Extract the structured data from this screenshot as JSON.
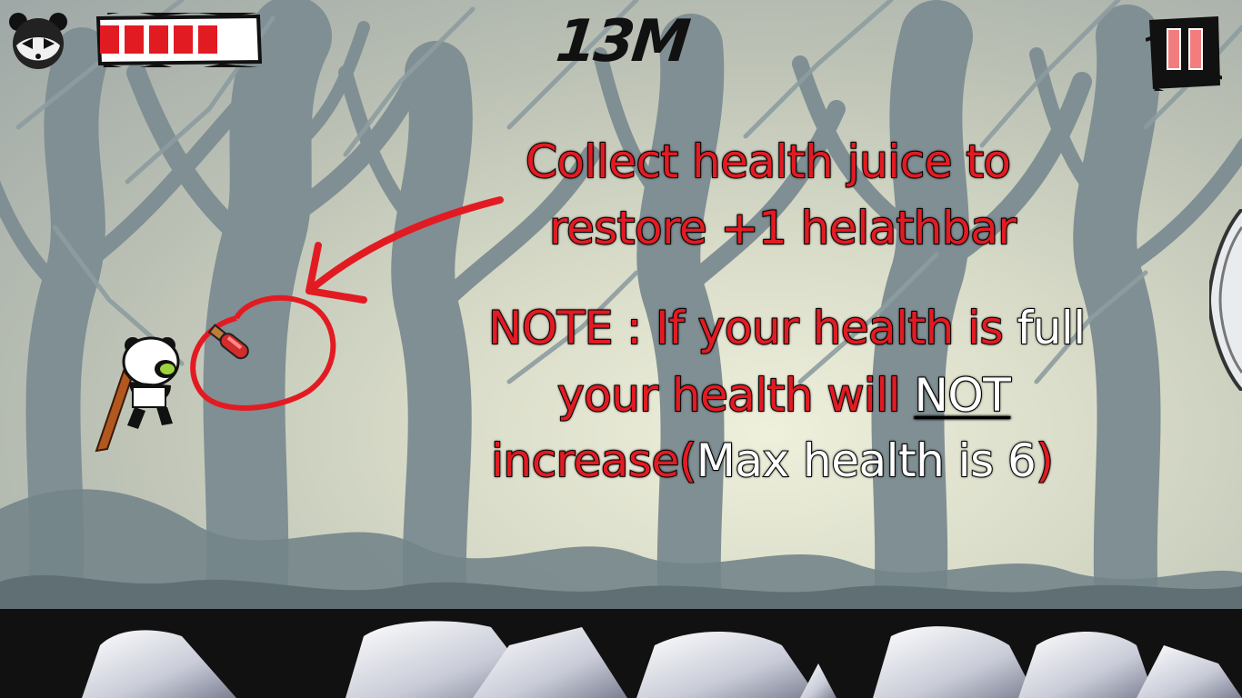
{
  "hud": {
    "distance": "13M",
    "health": {
      "filled": 5,
      "capacity": 6
    },
    "pause_icon": "pause-icon",
    "panda_icon": "panda-head-icon"
  },
  "tutorial": {
    "line1": "Collect health juice to",
    "line2": "restore +1 helathbar",
    "note_line1_red": "NOTE : If your health is",
    "note_line1_white": " full",
    "note_line2_red": "your health will ",
    "note_line2_white_underlined": "NOT",
    "note_line3_red": "increase(",
    "note_line3_white": "Max health is 6",
    "note_line3_close": ")"
  },
  "colors": {
    "accent_red": "#e21b23",
    "text_white": "#ffffff",
    "tree_silhouette": "#7b8b8f",
    "ground": "#111111"
  }
}
